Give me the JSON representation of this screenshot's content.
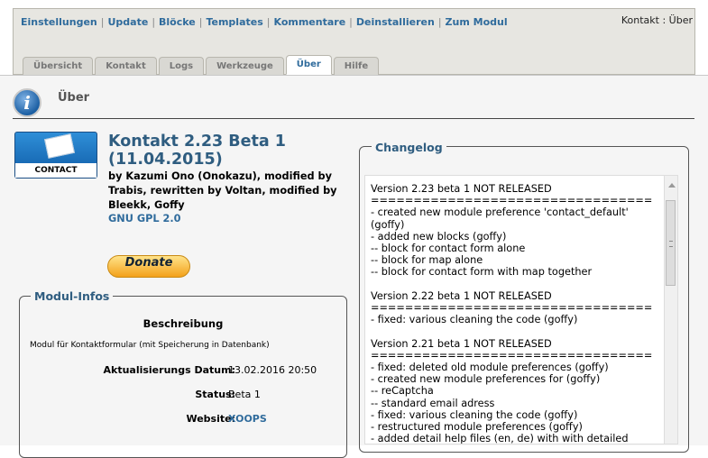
{
  "nav": {
    "items": [
      "Einstellungen",
      "Update",
      "Blöcke",
      "Templates",
      "Kommentare",
      "Deinstallieren",
      "Zum Modul"
    ],
    "breadcrumb": "Kontakt : Über"
  },
  "tabs": [
    {
      "label": "Übersicht",
      "active": false
    },
    {
      "label": "Kontakt",
      "active": false
    },
    {
      "label": "Logs",
      "active": false
    },
    {
      "label": "Werkzeuge",
      "active": false
    },
    {
      "label": "Über",
      "active": true
    },
    {
      "label": "Hilfe",
      "active": false
    }
  ],
  "page": {
    "title": "Über",
    "icon": "info-icon"
  },
  "module": {
    "logo_label": "CONTACT",
    "title": "Kontakt 2.23 Beta 1 (11.04.2015)",
    "authors": "by Kazumi Ono (Onokazu), modified by Trabis, rewritten by Voltan, modified by Bleekk, Goffy",
    "license": "GNU GPL 2.0",
    "donate_label": "Donate"
  },
  "modinfo": {
    "legend": "Modul-Infos",
    "desc_heading": "Beschreibung",
    "desc": "Modul für Kontaktformular (mit Speicherung in Datenbank)",
    "rows": [
      {
        "label": "Aktualisierungs Datum:",
        "value": "13.02.2016 20:50"
      },
      {
        "label": "Status:",
        "value": "Beta 1"
      },
      {
        "label": "Website:",
        "value": "XOOPS"
      }
    ]
  },
  "changelog": {
    "legend": "Changelog",
    "text": "Version 2.23 beta 1 NOT RELEASED\n=================================\n- created new module preference 'contact_default'\n(goffy)\n- added new blocks (goffy)\n-- block for contact form alone\n-- block for map alone\n-- block for contact form with map together\n\nVersion 2.22 beta 1 NOT RELEASED\n=================================\n- fixed: various cleaning the code (goffy)\n\nVersion 2.21 beta 1 NOT RELEASED\n=================================\n- fixed: deleted old module preferences (goffy)\n- created new module preferences for (goffy)\n-- reCaptcha\n-- standard email adress\n- fixed: various cleaning the code (goffy)\n- restructured module preferences (goffy)\n- added detail help files (en, de) with with detailed\n- "
  },
  "colors": {
    "link": "#2f6b9c",
    "heading": "#2f5d80"
  }
}
